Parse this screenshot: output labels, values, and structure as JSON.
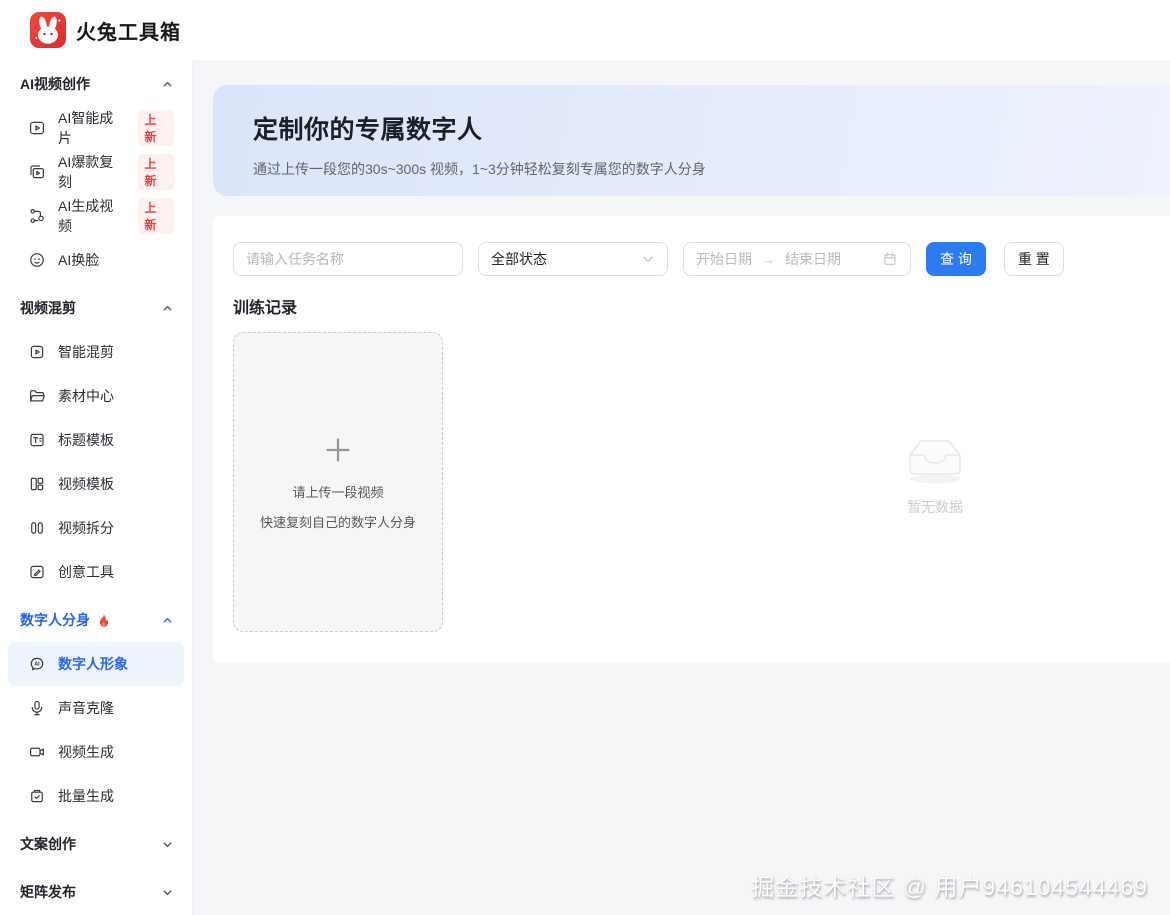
{
  "header": {
    "app_title": "火兔工具箱"
  },
  "sidebar": {
    "sections": [
      {
        "label": "AI视频创作",
        "state": "expanded",
        "items": [
          {
            "label": "AI智能成片",
            "badge": "上新",
            "icon": "ai-film-icon"
          },
          {
            "label": "AI爆款复刻",
            "badge": "上新",
            "icon": "ai-replicate-icon"
          },
          {
            "label": "AI生成视频",
            "badge": "上新",
            "icon": "ai-generate-video-icon"
          },
          {
            "label": "AI换脸",
            "icon": "face-swap-icon"
          }
        ]
      },
      {
        "label": "视频混剪",
        "state": "expanded",
        "items": [
          {
            "label": "智能混剪",
            "icon": "smart-mix-icon"
          },
          {
            "label": "素材中心",
            "icon": "folder-icon"
          },
          {
            "label": "标题模板",
            "icon": "title-template-icon"
          },
          {
            "label": "视频模板",
            "icon": "video-template-icon"
          },
          {
            "label": "视频拆分",
            "icon": "video-split-icon"
          },
          {
            "label": "创意工具",
            "icon": "creative-tools-icon"
          }
        ]
      },
      {
        "label": "数字人分身",
        "state": "expanded",
        "hot": true,
        "items": [
          {
            "label": "数字人形象",
            "icon": "digital-avatar-icon",
            "active": true
          },
          {
            "label": "声音克隆",
            "icon": "microphone-icon"
          },
          {
            "label": "视频生成",
            "icon": "video-camera-icon"
          },
          {
            "label": "批量生成",
            "icon": "batch-generate-icon"
          }
        ]
      },
      {
        "label": "文案创作",
        "state": "collapsed",
        "items": []
      },
      {
        "label": "矩阵发布",
        "state": "collapsed",
        "items": []
      }
    ]
  },
  "main": {
    "banner": {
      "title": "定制你的专属数字人",
      "subtitle": "通过上传一段您的30s~300s 视频，1~3分钟轻松复刻专属您的数字人分身"
    },
    "filters": {
      "task_name_placeholder": "请输入任务名称",
      "status_value": "全部状态",
      "date_start_placeholder": "开始日期",
      "date_separator": "→",
      "date_end_placeholder": "结束日期",
      "search_label": "查 询",
      "reset_label": "重 置"
    },
    "records": {
      "title": "训练记录",
      "upload_card": {
        "line1": "请上传一段视频",
        "line2": "快速复刻自己的数字人分身"
      },
      "empty_text": "暂无数据"
    }
  },
  "watermark": "掘金技术社区 @ 用户946104544469",
  "colors": {
    "accent_blue": "#2b7cf0",
    "brand_red": "#dd3333",
    "badge_red": "#f04142",
    "active_item_blue": "#2968ef",
    "section_hot_blue": "#2563eb",
    "main_background": "#f5f6f8",
    "banner_background": "#e2e9fb"
  }
}
